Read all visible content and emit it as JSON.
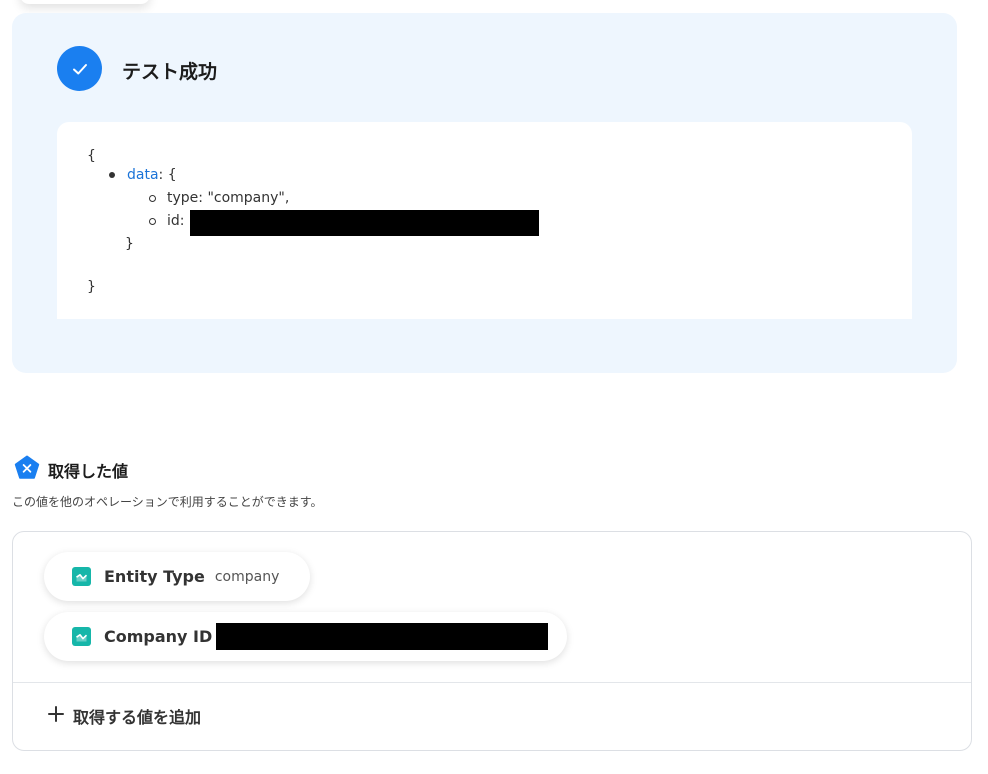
{
  "result": {
    "title": "テスト成功",
    "json_lines": {
      "open_brace": "{",
      "data_key": "data",
      "data_open": ": {",
      "type_line": "type: \"company\",",
      "id_label": "id:",
      "inner_close": "}",
      "close_brace": "}"
    }
  },
  "acquired": {
    "title": "取得した値",
    "description": "この値を他のオペレーションで利用することができます。",
    "items": [
      {
        "label": "Entity Type",
        "value": "company"
      },
      {
        "label": "Company ID",
        "value": ""
      }
    ],
    "add_label": "取得する値を追加"
  },
  "colors": {
    "accent": "#1a7ff0",
    "panel_bg": "#eef6fe",
    "chip_icon": "#16b6a9",
    "link": "#1a73d8"
  },
  "icons": {
    "success": "check-icon",
    "acquired": "pentagon-x-icon",
    "chip": "app-logo-icon",
    "add": "plus-icon"
  }
}
